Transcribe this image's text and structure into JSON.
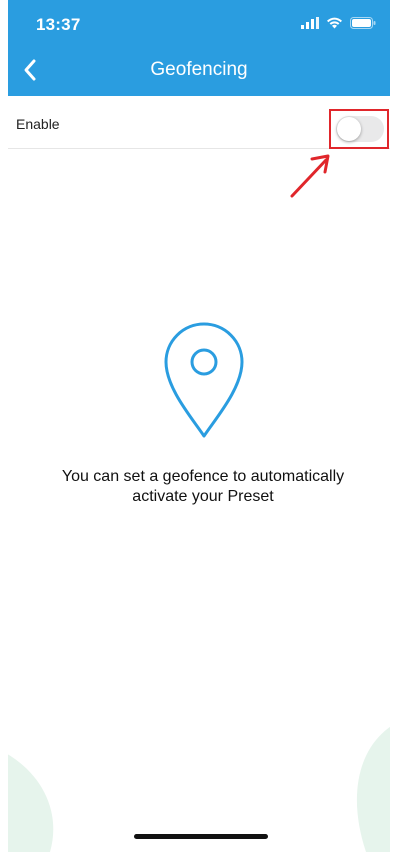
{
  "status_bar": {
    "time": "13:37",
    "icons": [
      "signal-icon",
      "wifi-icon",
      "battery-icon"
    ]
  },
  "nav": {
    "title": "Geofencing",
    "back_icon": "chevron-left-icon"
  },
  "settings": {
    "enable_label": "Enable",
    "enable_toggle_on": false
  },
  "empty_state": {
    "icon": "map-pin-icon",
    "message_line1": "You can set a geofence to automatically",
    "message_line2": "activate your Preset"
  },
  "annotation": {
    "highlight_color": "#e0262b"
  },
  "colors": {
    "header_bg": "#2a9de0",
    "accent": "#2a9de0",
    "leaf": "#e6f4ec"
  }
}
